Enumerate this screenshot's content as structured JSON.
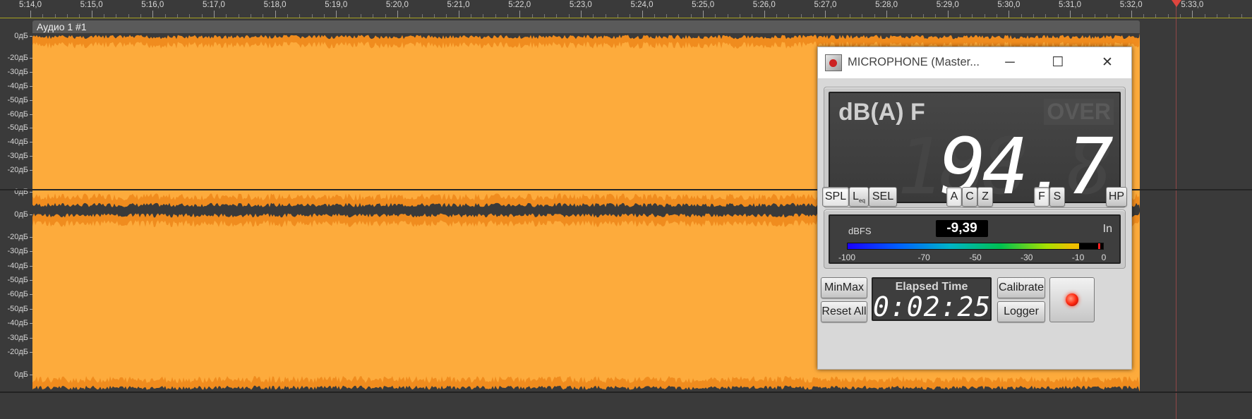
{
  "timeline": {
    "labels": [
      "5:14,0",
      "5:15,0",
      "5:16,0",
      "5:17,0",
      "5:18,0",
      "5:19,0",
      "5:20,0",
      "5:21,0",
      "5:22,0",
      "5:23,0",
      "5:24,0",
      "5:25,0",
      "5:26,0",
      "5:27,0",
      "5:28,0",
      "5:29,0",
      "5:30,0",
      "5:31,0",
      "5:32,0",
      "5:33,0"
    ]
  },
  "track": {
    "title": "Аудио 1 #1",
    "db_labels_ch1": [
      "0дБ",
      "-20дБ",
      "-30дБ",
      "-40дБ",
      "-50дБ",
      "-60дБ",
      "-50дБ",
      "-40дБ",
      "-30дБ",
      "-20дБ",
      "0дБ"
    ],
    "db_labels_ch2": [
      "0дБ",
      "-20дБ",
      "-30дБ",
      "-40дБ",
      "-50дБ",
      "-60дБ",
      "-50дБ",
      "-40дБ",
      "-30дБ",
      "-20дБ",
      "0дБ"
    ]
  },
  "colors": {
    "waveform": "#fdab3c",
    "waveform_dark": "#f08c1e",
    "ruler_line": "#a7a320"
  },
  "meter": {
    "window_title": "MICROPHONE (Master...",
    "window_controls": [
      "minimize-icon",
      "maximize-icon",
      "close-icon"
    ],
    "weighting": "dB(A) F",
    "over": "OVER",
    "ghost_digits": "188.8",
    "spl_value": "94.7",
    "buttons": {
      "spl": "SPL",
      "leq_main": "L",
      "leq_sub": "eq",
      "sel": "SEL",
      "a": "A",
      "c": "C",
      "z": "Z",
      "f": "F",
      "s": "S",
      "hp": "HP",
      "minmax": "MinMax",
      "reset_all": "Reset All",
      "calibrate": "Calibrate",
      "logger": "Logger"
    },
    "dbfs_label": "dBFS",
    "dbfs_value": "-9,39",
    "input_label": "In",
    "level_fraction": 0.905,
    "peak_fraction": 0.985,
    "scale_ticks": [
      "-100",
      "-70",
      "-50",
      "-30",
      "-10",
      "0"
    ],
    "scale_values": [
      -100,
      -70,
      -50,
      -30,
      -10,
      0
    ],
    "elapsed_label": "Elapsed Time",
    "elapsed_value": "0:02:25",
    "record_led": "record-led-icon"
  }
}
